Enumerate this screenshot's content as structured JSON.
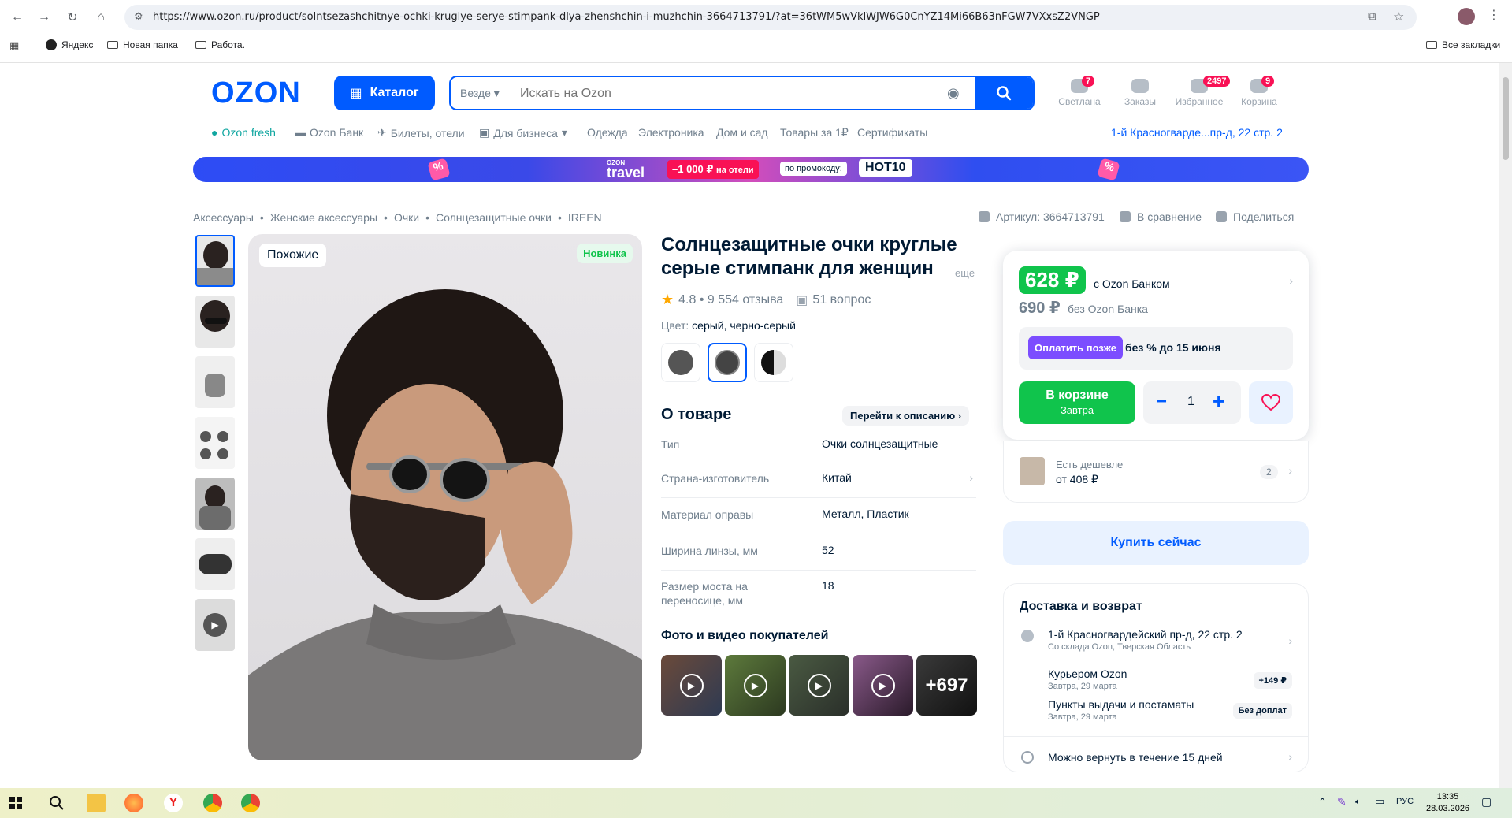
{
  "browser": {
    "url": "https://www.ozon.ru/product/solntsezashchitnye-ochki-kruglye-serye-stimpank-dlya-zhenshchin-i-muzhchin-3664713791/?at=36tWM5wVklWJW6G0CnYZ14Mi66B63nFGW7VXxsZ2VNGP",
    "bookmarks": [
      "Яндекс",
      "Новая папка",
      "Работа."
    ],
    "all_bookmarks": "Все закладки"
  },
  "header": {
    "logo": "OZON",
    "catalog_label": "Каталог",
    "search_scope": "Везде",
    "search_placeholder": "Искать на Ozon",
    "items": [
      {
        "label": "Светлана",
        "badge": "7"
      },
      {
        "label": "Заказы",
        "badge": ""
      },
      {
        "label": "Избранное",
        "badge": "2497"
      },
      {
        "label": "Корзина",
        "badge": "9"
      }
    ]
  },
  "subnav": {
    "items": [
      "Ozon fresh",
      "Ozon Банк",
      "Билеты, отели",
      "Для бизнеса",
      "Одежда",
      "Электроника",
      "Дом и сад",
      "Товары за 1₽",
      "Сертификаты"
    ],
    "address": "1-й Красногварде...пр-д, 22 стр. 2"
  },
  "banner": {
    "brand_top": "OZON",
    "brand": "travel",
    "discount": "–1 000 ₽",
    "discount_note": "на отели",
    "promo_label": "по промокоду:",
    "promo_code": "HOT10"
  },
  "breadcrumbs": [
    "Аксессуары",
    "Женские аксессуары",
    "Очки",
    "Солнцезащитные очки",
    "IREEN"
  ],
  "meta": {
    "article": "Артикул: 3664713791",
    "compare": "В сравнение",
    "share": "Поделиться"
  },
  "gallery": {
    "similar_label": "Похожие",
    "new_label": "Новинка"
  },
  "product": {
    "title": "Солнцезащитные очки круглые серые стимпанк для женщин",
    "more": "ещё",
    "rating": "4.8 • 9 554 отзыва",
    "questions": "51 вопрос",
    "color_label": "Цвет:",
    "color_value": "серый, черно-серый",
    "about_title": "О товаре",
    "to_description": "Перейти к описанию",
    "specs": [
      {
        "key": "Тип",
        "value": "Очки солнцезащитные"
      },
      {
        "key": "Страна-изготовитель",
        "value": "Китай"
      },
      {
        "key": "Материал оправы",
        "value": "Металл, Пластик"
      },
      {
        "key": "Ширина линзы, мм",
        "value": "52"
      },
      {
        "key": "Размер моста на переносице, мм",
        "value": "18"
      }
    ],
    "ugc_title": "Фото и видео покупателей",
    "ugc_more": "+697"
  },
  "price": {
    "bank_price": "628 ₽",
    "bank_note": "с Ozon Банком",
    "regular_price": "690 ₽",
    "regular_note": "без Ozon Банка",
    "pay_later": "Оплатить позже",
    "pay_later_note": "без % до 15 июня",
    "in_cart": "В корзине",
    "in_cart_sub": "Завтра",
    "qty": "1",
    "cheaper_label": "Есть дешевле",
    "cheaper_price": "от 408 ₽",
    "cheaper_count": "2",
    "buy_now": "Купить сейчас"
  },
  "delivery": {
    "title": "Доставка и возврат",
    "address": "1-й Красногвардейский пр-д, 22 стр. 2",
    "address_sub": "Со склада Ozon, Тверская Область",
    "courier": "Курьером Ozon",
    "courier_sub": "Завтра, 29 марта",
    "courier_tag": "+149 ₽",
    "pickup": "Пункты выдачи и постаматы",
    "pickup_sub": "Завтра, 29 марта",
    "pickup_tag": "Без доплат",
    "return": "Можно вернуть в течение 15 дней"
  },
  "taskbar": {
    "lang": "РУС",
    "time": "13:35",
    "date": "28.03.2026"
  },
  "colors": {
    "accent": "#005bff",
    "price_green": "#10c44c",
    "badge_pink": "#f91155",
    "pay_later_purple": "#7c4dff"
  }
}
